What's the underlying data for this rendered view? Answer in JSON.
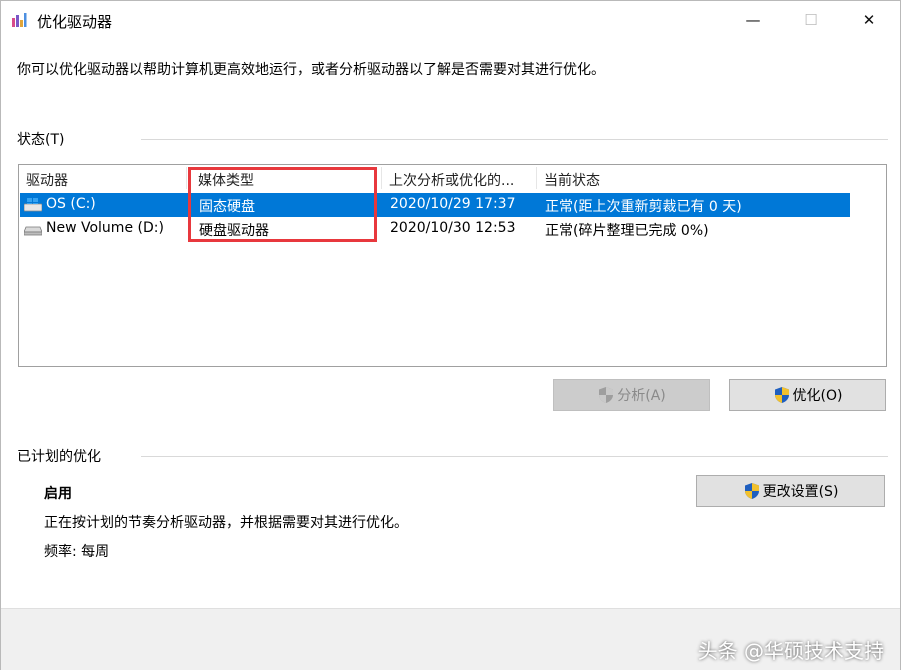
{
  "window": {
    "title": "优化驱动器"
  },
  "window_controls": {
    "minimize": "—",
    "maximize": "☐",
    "close": "✕"
  },
  "description": "你可以优化驱动器以帮助计算机更高效地运行，或者分析驱动器以了解是否需要对其进行优化。",
  "status_section": {
    "label": "状态(T)",
    "columns": [
      "驱动器",
      "媒体类型",
      "上次分析或优化的...",
      "当前状态"
    ],
    "rows": [
      {
        "drive": "OS (C:)",
        "media": "固态硬盘",
        "last": "2020/10/29 17:37",
        "status": "正常(距上次重新剪裁已有 0 天)",
        "icon": "windows-drive-icon",
        "selected": true
      },
      {
        "drive": "New Volume (D:)",
        "media": "硬盘驱动器",
        "last": "2020/10/30 12:53",
        "status": "正常(碎片整理已完成 0%)",
        "icon": "hard-drive-icon",
        "selected": false
      }
    ]
  },
  "buttons": {
    "analyze": "分析(A)",
    "optimize": "优化(O)",
    "change_settings": "更改设置(S)"
  },
  "scheduled": {
    "label": "已计划的优化",
    "state": "启用",
    "desc": "正在按计划的节奏分析驱动器，并根据需要对其进行优化。",
    "frequency": "频率: 每周"
  },
  "watermark": "头条 @华硕技术支持",
  "colors": {
    "selection": "#0078d7",
    "highlight_box": "#e8383d",
    "shield_blue": "#1f5fbf",
    "shield_yellow": "#f2c12e"
  }
}
